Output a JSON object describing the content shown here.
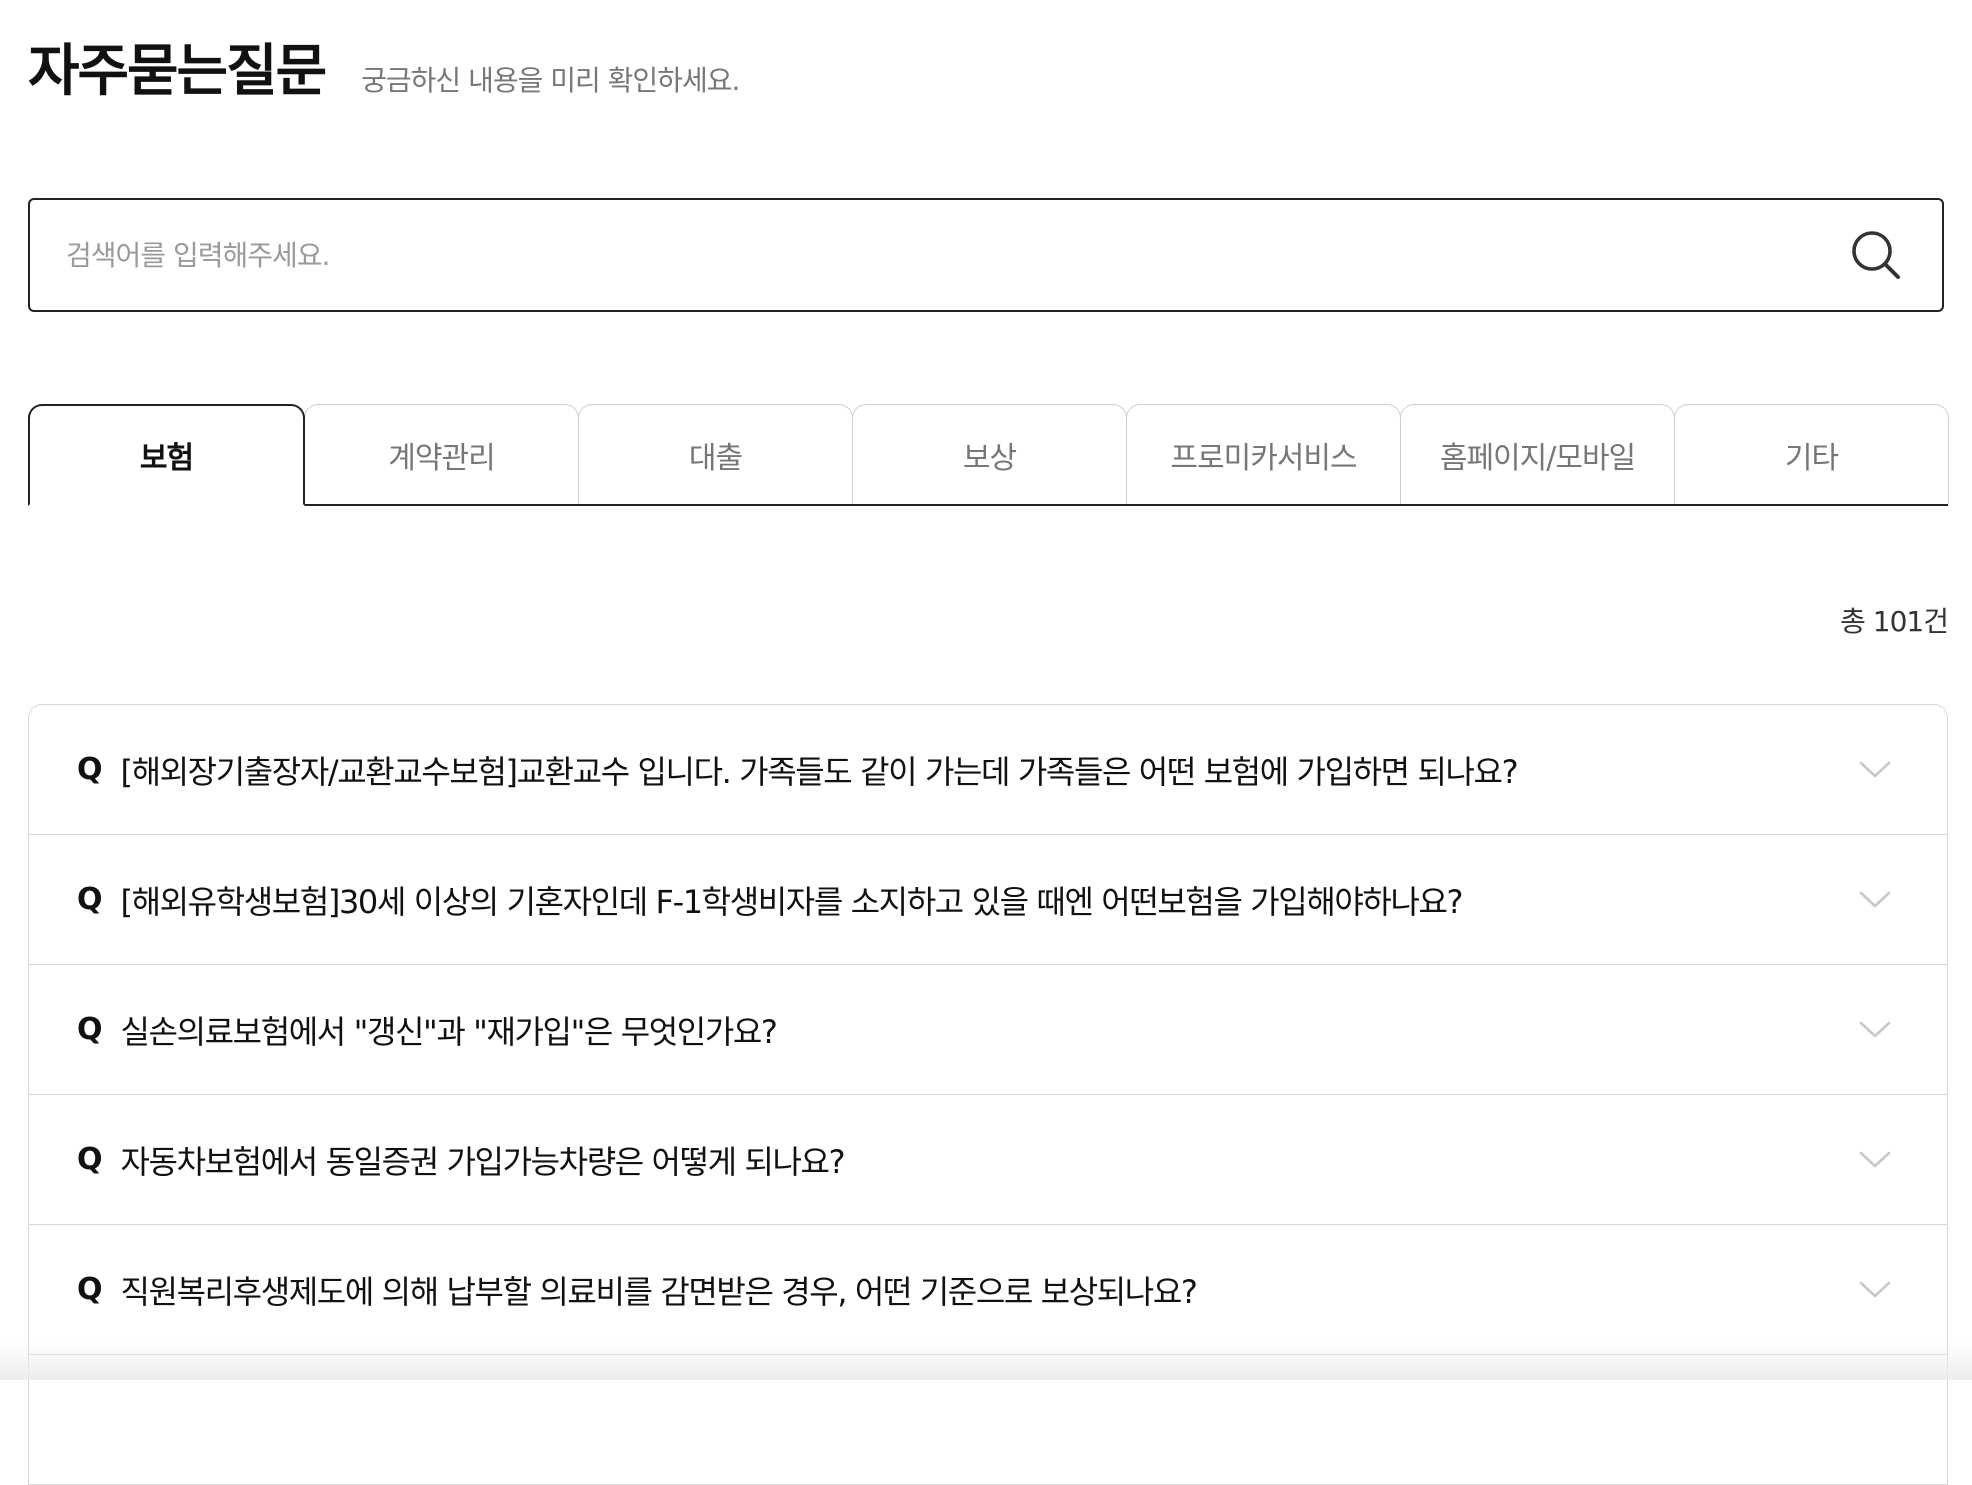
{
  "header": {
    "title": "자주묻는질문",
    "subtitle": "궁금하신 내용을 미리 확인하세요."
  },
  "search": {
    "placeholder": "검색어를 입력해주세요.",
    "value": "",
    "icon": "search-icon"
  },
  "tabs": [
    {
      "label": "보험",
      "active": true
    },
    {
      "label": "계약관리",
      "active": false
    },
    {
      "label": "대출",
      "active": false
    },
    {
      "label": "보상",
      "active": false
    },
    {
      "label": "프로미카서비스",
      "active": false
    },
    {
      "label": "홈페이지/모바일",
      "active": false
    },
    {
      "label": "기타",
      "active": false
    }
  ],
  "total": {
    "label": "총 101건"
  },
  "faq": {
    "prefix": "Q",
    "items": [
      {
        "question": "[해외장기출장자/교환교수보험]교환교수 입니다. 가족들도 같이 가는데 가족들은 어떤 보험에 가입하면 되나요?"
      },
      {
        "question": "[해외유학생보험]30세 이상의 기혼자인데 F-1학생비자를 소지하고 있을 때엔 어떤보험을 가입해야하나요?"
      },
      {
        "question": "실손의료보험에서 \"갱신\"과 \"재가입\"은 무엇인가요?"
      },
      {
        "question": "자동차보험에서 동일증권 가입가능차량은 어떻게 되나요?"
      },
      {
        "question": "직원복리후생제도에 의해 납부할 의료비를 감면받은 경우, 어떤 기준으로 보상되나요?"
      }
    ]
  },
  "colors": {
    "border_dark": "#222222",
    "border_light": "#d7d7d7",
    "text_muted": "#777777",
    "chevron": "#c8c8c8"
  }
}
